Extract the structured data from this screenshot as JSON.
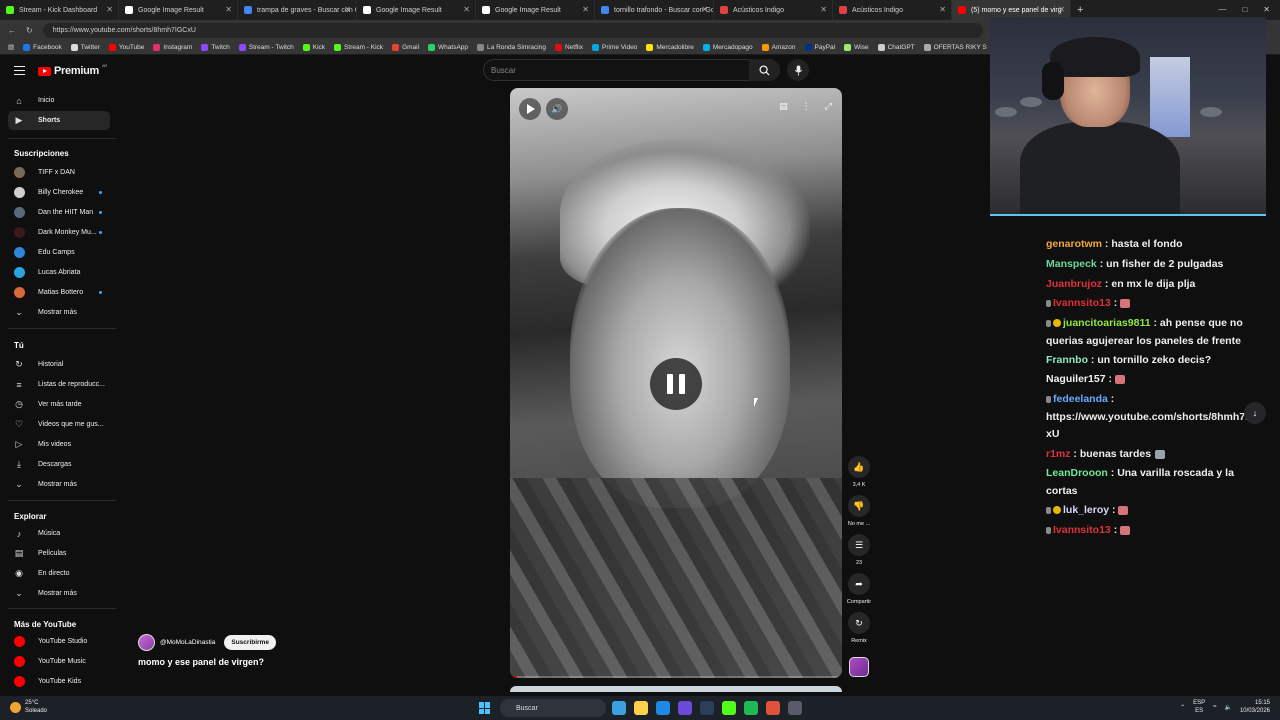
{
  "browser": {
    "tabs": [
      {
        "label": "Stream - Kick Dashboard",
        "color": "#53fc18"
      },
      {
        "label": "Google Image Result",
        "color": "#ffffff"
      },
      {
        "label": "trampa de graves - Buscar con Go",
        "color": "#4285f4"
      },
      {
        "label": "Google Image Result",
        "color": "#ffffff"
      },
      {
        "label": "Google Image Result",
        "color": "#ffffff"
      },
      {
        "label": "tornillo trafondo - Buscar con Go",
        "color": "#4285f4"
      },
      {
        "label": "Acústicos Indigo",
        "color": "#e04040"
      },
      {
        "label": "Acústicos Indigo",
        "color": "#e04040"
      },
      {
        "label": "(5) momo y ese panel de virg",
        "color": "#ff0000"
      }
    ],
    "url": "https://www.youtube.com/shorts/8hmh7IGCxU",
    "bookmarks": [
      {
        "label": "Facebook",
        "color": "#1877f2"
      },
      {
        "label": "Twitter",
        "color": "#dddddd"
      },
      {
        "label": "YouTube",
        "color": "#ff0000"
      },
      {
        "label": "Instagram",
        "color": "#e1306c"
      },
      {
        "label": "Twitch",
        "color": "#9146ff"
      },
      {
        "label": "Stream - Twitch",
        "color": "#9146ff"
      },
      {
        "label": "Kick",
        "color": "#53fc18"
      },
      {
        "label": "Stream - Kick",
        "color": "#53fc18"
      },
      {
        "label": "Gmail",
        "color": "#ea4335"
      },
      {
        "label": "WhatsApp",
        "color": "#25d366"
      },
      {
        "label": "La Ronda Simracing",
        "color": "#888888"
      },
      {
        "label": "Netflix",
        "color": "#e50914"
      },
      {
        "label": "Prime Video",
        "color": "#00a8e1"
      },
      {
        "label": "Mercadolibre",
        "color": "#ffe600"
      },
      {
        "label": "Mercadopago",
        "color": "#00b1ea"
      },
      {
        "label": "Amazon",
        "color": "#ff9900"
      },
      {
        "label": "PayPal",
        "color": "#003087"
      },
      {
        "label": "Wise",
        "color": "#9fe870"
      },
      {
        "label": "ChatGPT",
        "color": "#cccccc"
      },
      {
        "label": "OFERTAS RIKY S",
        "color": "#aaaaaa"
      }
    ]
  },
  "youtube": {
    "logo_text": "Premium",
    "logo_country": "AR",
    "search_placeholder": "Buscar",
    "sidebar": {
      "main": [
        {
          "label": "Inicio",
          "icon": "home-icon"
        },
        {
          "label": "Shorts",
          "icon": "shorts-icon",
          "active": true
        }
      ],
      "subs_heading": "Suscripciones",
      "subs": [
        {
          "label": "TIFF x DAN",
          "color": "#7a6a5a",
          "live": false
        },
        {
          "label": "Billy Cherokee",
          "color": "#cfcfcf",
          "live": true
        },
        {
          "label": "Dan the HIIT Man",
          "color": "#5a6a7a",
          "live": true
        },
        {
          "label": "Dark Monkey Mu...",
          "color": "#3a1a1a",
          "live": true
        },
        {
          "label": "Edu Camps",
          "color": "#2f86d8",
          "live": false
        },
        {
          "label": "Lucas Abriata",
          "color": "#2aa3e0",
          "live": false
        },
        {
          "label": "Matias Bottero",
          "color": "#d86a3a",
          "live": true
        }
      ],
      "subs_more": "Mostrar más",
      "you_heading": "Tú",
      "you": [
        {
          "label": "Historial",
          "icon": "history-icon"
        },
        {
          "label": "Listas de reproducc...",
          "icon": "playlist-icon"
        },
        {
          "label": "Ver más tarde",
          "icon": "clock-icon"
        },
        {
          "label": "Videos que me gus...",
          "icon": "like-icon"
        },
        {
          "label": "Mis videos",
          "icon": "my-videos-icon"
        },
        {
          "label": "Descargas",
          "icon": "download-icon"
        }
      ],
      "you_more": "Mostrar más",
      "explore_heading": "Explorar",
      "explore": [
        {
          "label": "Música",
          "icon": "music-icon"
        },
        {
          "label": "Películas",
          "icon": "film-icon"
        },
        {
          "label": "En directo",
          "icon": "live-icon"
        }
      ],
      "explore_more": "Mostrar más",
      "more_heading": "Más de YouTube",
      "more": [
        {
          "label": "YouTube Studio",
          "color": "#ff0000"
        },
        {
          "label": "YouTube Music",
          "color": "#ff0000"
        },
        {
          "label": "YouTube Kids",
          "color": "#ff0000"
        }
      ]
    },
    "short": {
      "channel": "@MoMoLaDinastia",
      "subscribe": "Suscribirme",
      "title": "momo y ese panel de virgen?",
      "likes": "3,4 K",
      "dislike": "No me ...",
      "comments": "23",
      "share": "Compartir",
      "remix": "Remix",
      "progress": 0.02
    }
  },
  "chat": [
    {
      "user": "genarotwm",
      "color": "#f2a73e",
      "text": "hasta el fondo",
      "badges": []
    },
    {
      "user": "Manspeck",
      "color": "#6fd89a",
      "text": "un fisher de 2 pulgadas",
      "badges": []
    },
    {
      "user": "Juanbrujoz",
      "color": "#e0303a",
      "text": "en mx le dija plja",
      "badges": []
    },
    {
      "user": "Ivannsito13",
      "color": "#e0303a",
      "text": "",
      "badges": [
        "mic"
      ],
      "emote": true
    },
    {
      "user": "juancitoarias9811",
      "color": "#8fe84a",
      "text": "ah pense que no querias agujerear los paneles de frente",
      "badges": [
        "mic",
        "gold"
      ]
    },
    {
      "user": "Frannbo",
      "color": "#8fe8c0",
      "text": "un tornillo zeko decis?",
      "badges": []
    },
    {
      "user": "Naguiler157",
      "color": "#f1f1f1",
      "text": "",
      "badges": [],
      "emote": true
    },
    {
      "user": "fedeelanda",
      "color": "#6aa8ff",
      "text": "https://www.youtube.com/shorts/8hmh7IGCxU",
      "badges": [
        "mic"
      ]
    },
    {
      "user": "r1mz",
      "color": "#e0303a",
      "text": "buenas tardes",
      "badges": [],
      "emote": true
    },
    {
      "user": "LeanDrooon",
      "color": "#6fe89a",
      "text": "Una varilla roscada y la cortas",
      "badges": []
    },
    {
      "user": "luk_leroy",
      "color": "#d8d8ff",
      "text": "",
      "badges": [
        "mic",
        "gold"
      ],
      "emote": true
    },
    {
      "user": "Ivannsito13",
      "color": "#e0303a",
      "text": "",
      "badges": [
        "mic"
      ],
      "emote": true
    }
  ],
  "taskbar": {
    "weather_temp": "25°C",
    "weather_desc": "Soleado",
    "search": "Buscar",
    "lang1": "ESP",
    "lang2": "ES",
    "time": "15:15",
    "date": "10/03/2026"
  }
}
